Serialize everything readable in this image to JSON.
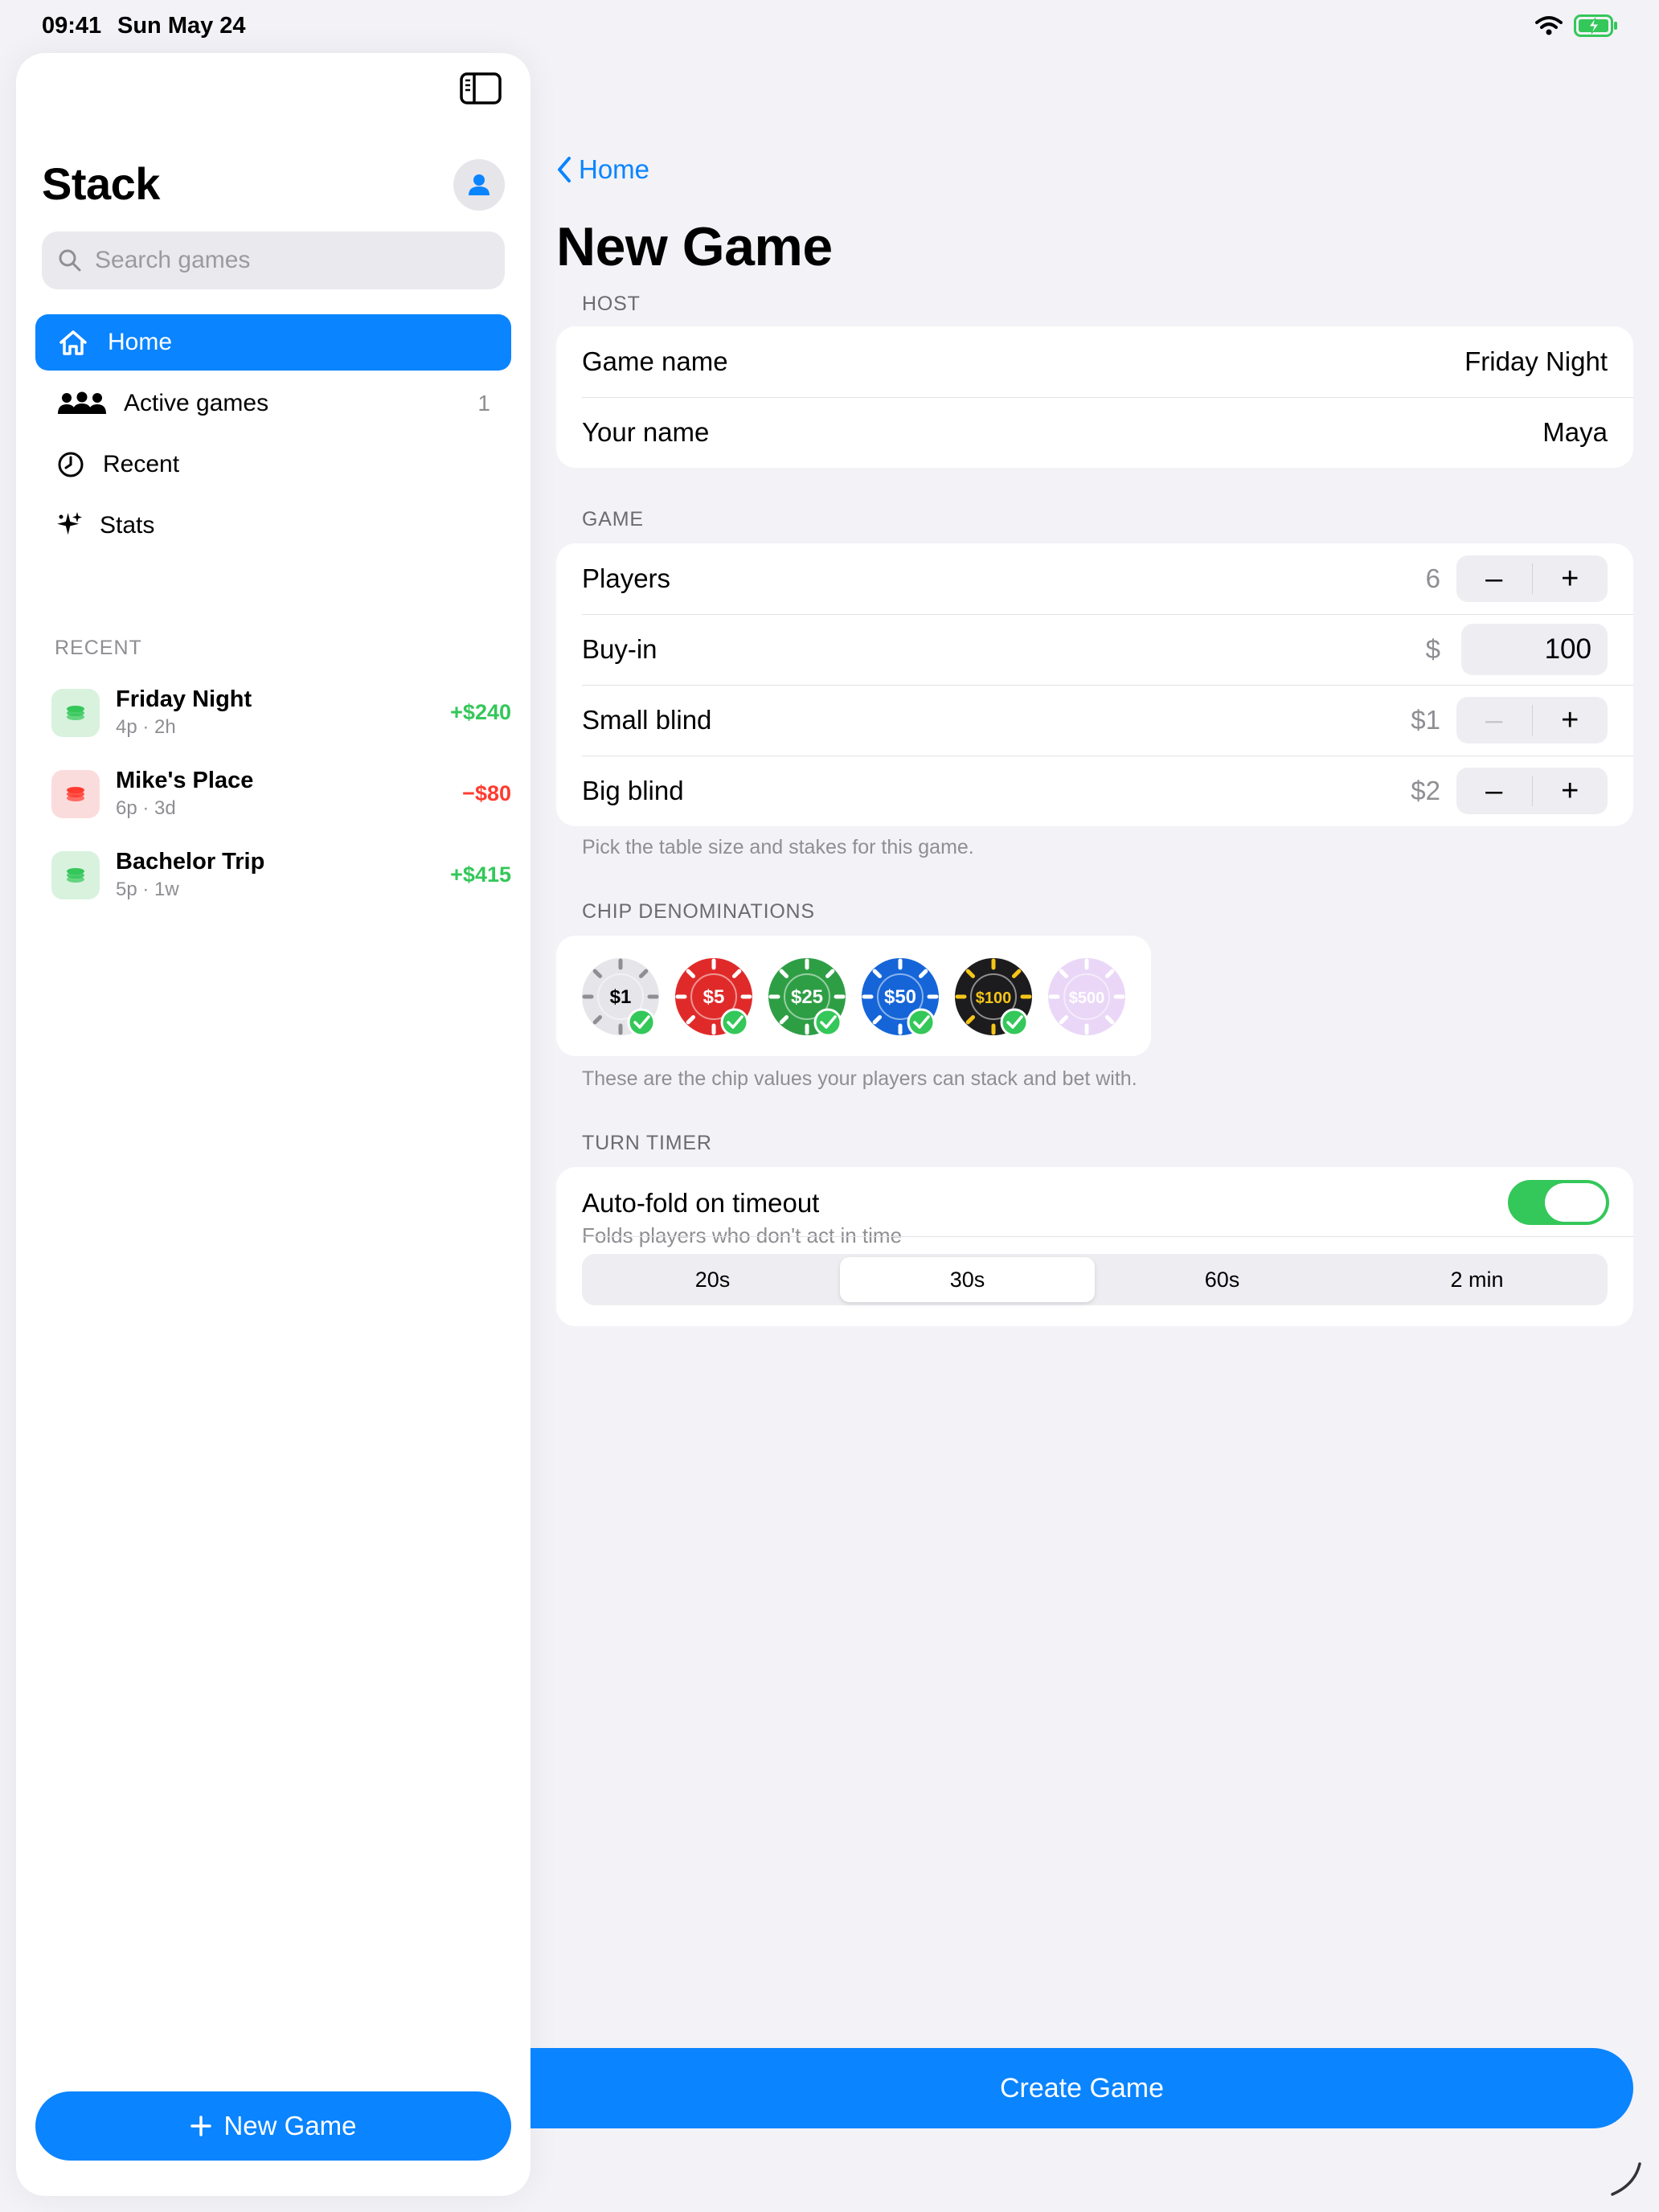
{
  "status_bar": {
    "time": "09:41",
    "date": "Sun May 24"
  },
  "sidebar": {
    "title": "Stack",
    "search": {
      "placeholder": "Search games",
      "value": ""
    },
    "nav": [
      {
        "label": "Home",
        "icon": "house-icon"
      },
      {
        "label": "Active games",
        "icon": "people-icon",
        "count": "1"
      },
      {
        "label": "Recent",
        "icon": "clock-icon"
      },
      {
        "label": "Stats",
        "icon": "sparkles-icon"
      }
    ],
    "recent_header": "RECENT",
    "recent": [
      {
        "name": "Friday Night",
        "meta": "4p · 2h",
        "amount": "+$240",
        "tone": "positive"
      },
      {
        "name": "Mike's Place",
        "meta": "6p · 3d",
        "amount": "−$80",
        "tone": "negative"
      },
      {
        "name": "Bachelor Trip",
        "meta": "5p · 1w",
        "amount": "+$415",
        "tone": "positive"
      }
    ],
    "new_game_label": "New Game"
  },
  "main": {
    "back_label": "Home",
    "title": "New Game",
    "host": {
      "header": "HOST",
      "game_name_label": "Game name",
      "game_name_value": "Friday Night",
      "your_name_label": "Your name",
      "your_name_value": "Maya"
    },
    "game": {
      "header": "GAME",
      "players_label": "Players",
      "players_value": "6",
      "buyin_label": "Buy-in",
      "buyin_prefix": "$",
      "buyin_value": "100",
      "small_blind_label": "Small blind",
      "small_blind_value": "$1",
      "big_blind_label": "Big blind",
      "big_blind_value": "$2",
      "minus": "–",
      "plus": "+",
      "footnote": "Pick the table size and stakes for this game."
    },
    "chips": {
      "header": "CHIP DENOMINATIONS",
      "items": [
        {
          "label": "$1",
          "color": "#e5e5ea",
          "text_color": "#000000",
          "selected": true
        },
        {
          "label": "$5",
          "color": "#e02a2a",
          "text_color": "#ffffff",
          "selected": true
        },
        {
          "label": "$25",
          "color": "#2e9e45",
          "text_color": "#ffffff",
          "selected": true
        },
        {
          "label": "$50",
          "color": "#1565d8",
          "text_color": "#ffffff",
          "selected": true
        },
        {
          "label": "$100",
          "color": "#1c1c1e",
          "text_color": "#f5c518",
          "selected": true
        },
        {
          "label": "$500",
          "color": "#d9b8f2",
          "text_color": "#ffffff",
          "selected": false
        }
      ],
      "footnote": "These are the chip values your players can stack and bet with."
    },
    "timer": {
      "header": "TURN TIMER",
      "title": "Auto-fold on timeout",
      "subtitle": "Folds players who don't act in time",
      "enabled": true,
      "options": [
        "20s",
        "30s",
        "60s",
        "2 min"
      ],
      "selected": "30s"
    },
    "create_label": "Create Game"
  },
  "colors": {
    "accent": "#0a84ff",
    "positive": "#34c759",
    "negative": "#ff3b30"
  }
}
